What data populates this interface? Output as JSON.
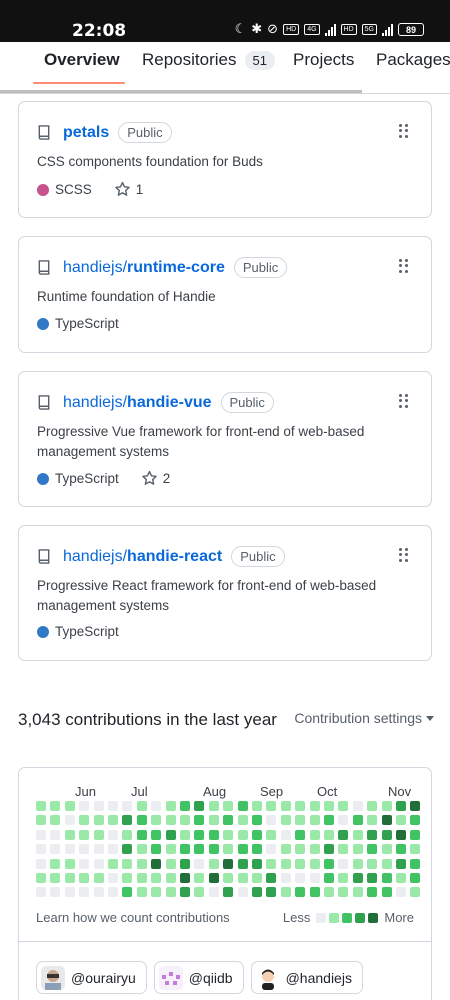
{
  "status_bar": {
    "time": "22:08",
    "network_tags": [
      "HD",
      "4G",
      "HD",
      "5G"
    ],
    "battery": "89"
  },
  "tabs": [
    {
      "label": "Overview",
      "active": true
    },
    {
      "label": "Repositories",
      "counter": "51"
    },
    {
      "label": "Projects"
    },
    {
      "label": "Packages"
    }
  ],
  "repos": [
    {
      "owner": "",
      "name": "petals",
      "visibility": "Public",
      "description": "CSS components foundation for Buds",
      "language": "SCSS",
      "language_color": "#c6538c",
      "stars": "1"
    },
    {
      "owner": "handiejs/",
      "name": "runtime-core",
      "visibility": "Public",
      "description": "Runtime foundation of Handie",
      "language": "TypeScript",
      "language_color": "#3178c6",
      "stars": null
    },
    {
      "owner": "handiejs/",
      "name": "handie-vue",
      "visibility": "Public",
      "description": "Progressive Vue framework for front-end of web-based management systems",
      "language": "TypeScript",
      "language_color": "#3178c6",
      "stars": "2"
    },
    {
      "owner": "handiejs/",
      "name": "handie-react",
      "visibility": "Public",
      "description": "Progressive React framework for front-end of web-based management systems",
      "language": "TypeScript",
      "language_color": "#3178c6",
      "stars": null
    }
  ],
  "contributions": {
    "title": "3,043 contributions in the last year",
    "settings_label": "Contribution settings",
    "months": [
      "Jun",
      "Jul",
      "Aug",
      "Sep",
      "Oct",
      "Nov"
    ],
    "learn_label": "Learn how we count contributions",
    "legend_less": "Less",
    "legend_more": "More",
    "legend_colors": [
      "#ebedf0",
      "#9be9a8",
      "#40c463",
      "#30a14e",
      "#216e39"
    ],
    "orgs": [
      "@ourairyu",
      "@qiidb",
      "@handiejs"
    ]
  }
}
